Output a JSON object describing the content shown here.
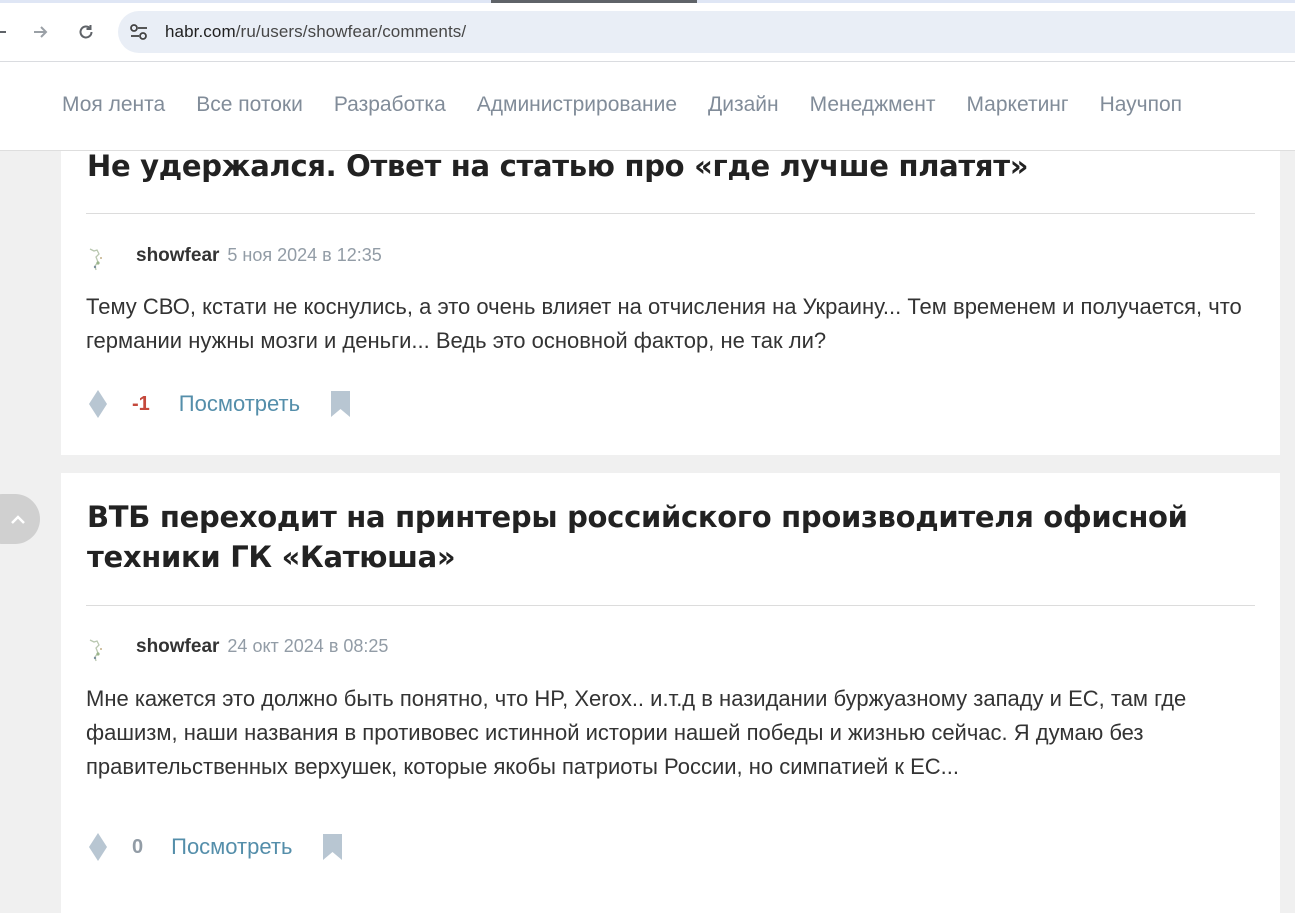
{
  "browser": {
    "url_host": "habr.com",
    "url_path": "/ru/users/showfear/comments/",
    "back_icon": "arrow-left-icon",
    "forward_icon": "arrow-right-icon",
    "reload_icon": "reload-icon",
    "site_settings_icon": "tune-icon"
  },
  "header": {
    "nav_items": [
      "Моя лента",
      "Все потоки",
      "Разработка",
      "Администрирование",
      "Дизайн",
      "Менеджмент",
      "Маркетинг",
      "Научпоп"
    ]
  },
  "comments": [
    {
      "article_title": "Не удержался. Ответ на статью про «где лучше платят»",
      "author": "showfear",
      "datetime": "5 ноя 2024 в 12:35",
      "text": "Тему СВО, кстати не коснулись, а это очень влияет на отчисления на Украину... Тем временем и получается, что германии нужны мозги и деньги... Ведь это основной фактор, не так ли?",
      "score": "-1",
      "view_label": "Посмотреть"
    },
    {
      "article_title": "ВТБ переходит на принтеры российского производителя офисной техники ГК «Катюша»",
      "author": "showfear",
      "datetime": "24 окт 2024 в 08:25",
      "text": "Мне кажется это должно быть понятно, что HP, Xerox.. и.т.д в назидании буржуазному западу и ЕС, там где фашизм, наши названия в противовес истинной истории нашей победы и жизнью сейчас. Я думаю без правительственных верхушек, которые якобы патриоты России, но симпатией к ЕС...",
      "score": "0",
      "view_label": "Посмотреть"
    }
  ],
  "colors": {
    "page_bg": "#f0f0f0",
    "nav_text": "#818c99",
    "link": "#548eaa",
    "negative_score": "#c5493c",
    "neutral_score": "#929ca6"
  }
}
